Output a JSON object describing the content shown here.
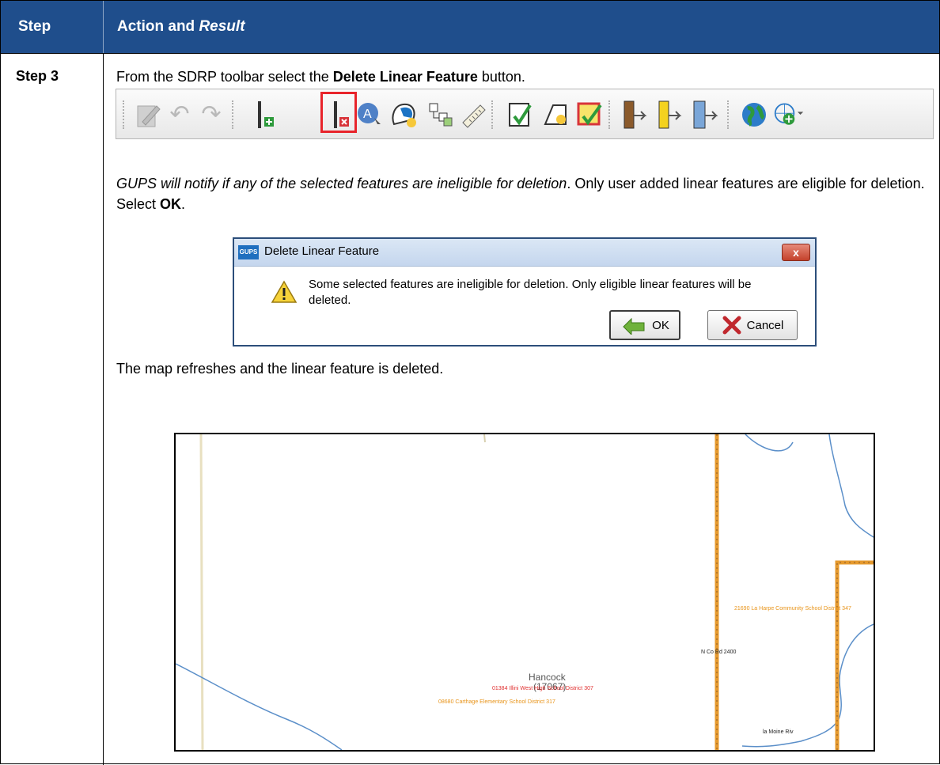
{
  "header": {
    "step_col": "Step",
    "action_col": "Action and",
    "action_col_italic": "Result"
  },
  "row": {
    "step": "Step 3",
    "instruction_pre": "From the SDRP toolbar select the ",
    "instruction_bold": "Delete Linear Feature",
    "instruction_post": " button.",
    "notify_italic": "GUPS will notify if any of the selected features are ineligible for deletion",
    "notify_rest": ". Only user added linear features are eligible for deletion. Select ",
    "notify_bold": "OK",
    "notify_end": ".",
    "result_text": "The map refreshes and the linear feature is deleted."
  },
  "toolbar": {
    "icons": [
      "edit-pencil-icon",
      "undo-icon",
      "redo-icon",
      "add-linear-feature-icon",
      "delete-linear-feature-icon",
      "select-feature-icon",
      "rename-feature-icon",
      "attributes-icon",
      "measure-icon",
      "validate-icon",
      "shape-icon",
      "review-icon",
      "import-icon",
      "export-icon",
      "export-map-icon",
      "globe-icon",
      "add-layer-icon"
    ]
  },
  "dialog": {
    "logo": "GUPS",
    "title": "Delete Linear Feature",
    "close": "x",
    "message": "Some selected features are ineligible for deletion. Only eligible linear features will be deleted.",
    "ok": "OK",
    "cancel": "Cancel"
  },
  "map": {
    "county_name": "Hancock",
    "county_code": "(17067)",
    "label_red": "01384 Illini West High School District 307",
    "label_orange_1": "08680 Carthage Elementary School District 317",
    "label_orange_2": "21690 La Harpe Community School District 347",
    "road_label": "N Co Rd 2400",
    "river_label": "la Moine Riv",
    "colors": {
      "river": "#5b8fc9",
      "boundary": "#e69a2e",
      "road": "#e8e0c0",
      "red_label": "#e03030",
      "orange_label": "#e8941a"
    }
  }
}
